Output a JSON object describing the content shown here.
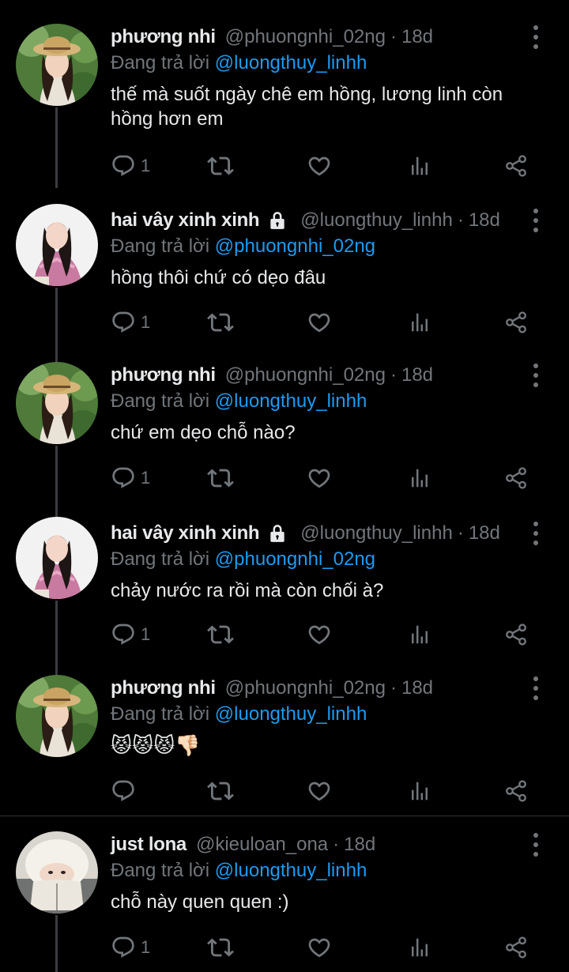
{
  "tweets": [
    {
      "name": "phương nhi",
      "handle": "@phuongnhi_02ng",
      "time": "18d",
      "locked": false,
      "replying_prefix": "Đang trả lời ",
      "replying_to": "@luongthuy_linhh",
      "text": "thế mà suốt ngày chê em hồng, lương linh còn hồng hơn em",
      "reply_count": "1",
      "avatar": "avatar-straw-hat-girl"
    },
    {
      "name": "hai vây xinh xinh",
      "handle": "@luongthuy_linhh",
      "time": "18d",
      "locked": true,
      "replying_prefix": "Đang trả lời ",
      "replying_to": "@phuongnhi_02ng",
      "text": "hồng thôi chứ có dẹo đâu",
      "reply_count": "1",
      "avatar": "avatar-pink-cardigan-girl"
    },
    {
      "name": "phương nhi",
      "handle": "@phuongnhi_02ng",
      "time": "18d",
      "locked": false,
      "replying_prefix": "Đang trả lời ",
      "replying_to": "@luongthuy_linhh",
      "text": "chứ em dẹo chỗ nào?",
      "reply_count": "1",
      "avatar": "avatar-straw-hat-girl"
    },
    {
      "name": "hai vây xinh xinh",
      "handle": "@luongthuy_linhh",
      "time": "18d",
      "locked": true,
      "replying_prefix": "Đang trả lời ",
      "replying_to": "@phuongnhi_02ng",
      "text": "chảy nước ra rồi mà còn chối à?",
      "reply_count": "1",
      "avatar": "avatar-pink-cardigan-girl"
    },
    {
      "name": "phương nhi",
      "handle": "@phuongnhi_02ng",
      "time": "18d",
      "locked": false,
      "replying_prefix": "Đang trả lời ",
      "replying_to": "@luongthuy_linhh",
      "text": "😾😾😾👎🏻",
      "reply_count": "",
      "avatar": "avatar-straw-hat-girl"
    },
    {
      "name": "just lona",
      "handle": "@kieuloan_ona",
      "time": "18d",
      "locked": false,
      "replying_prefix": "Đang trả lời ",
      "replying_to": "@luongthuy_linhh",
      "text": "chỗ này quen quen :)",
      "reply_count": "1",
      "avatar": "avatar-white-hat-girl"
    }
  ],
  "icons": {
    "reply": "reply-icon",
    "retweet": "retweet-icon",
    "like": "heart-icon",
    "views": "views-icon",
    "share": "share-icon",
    "more": "more-vertical-icon",
    "lock": "lock-icon"
  },
  "colors": {
    "background": "#000000",
    "text": "#e7e9ea",
    "muted": "#71767b",
    "link": "#1d9bf0"
  }
}
